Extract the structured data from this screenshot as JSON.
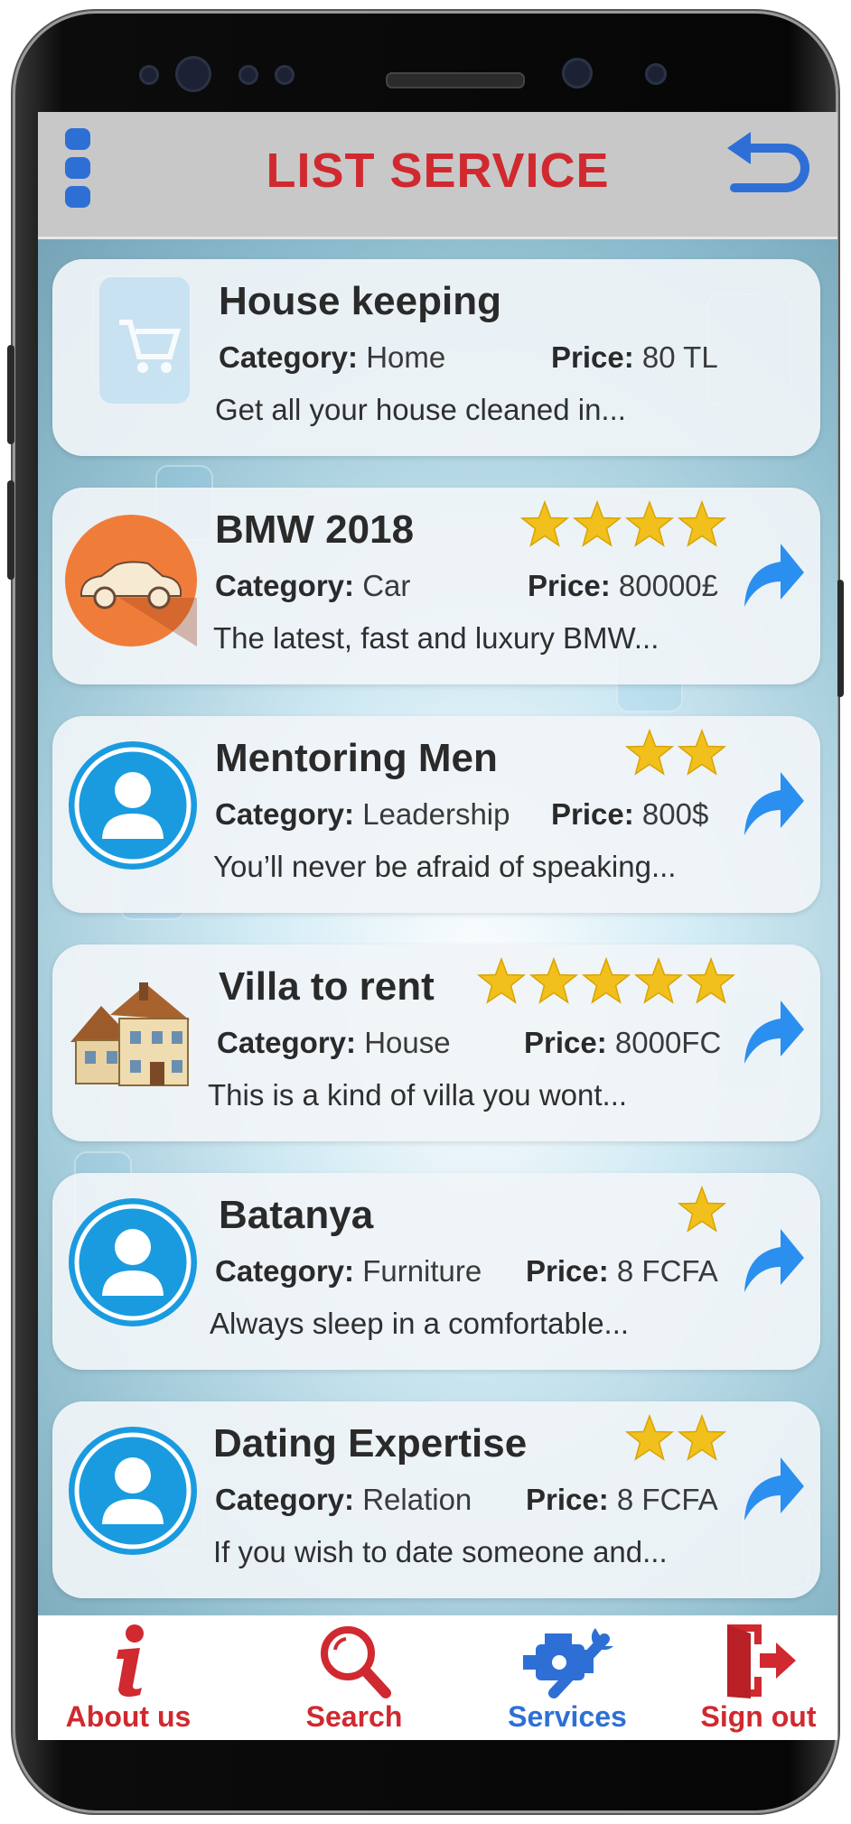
{
  "header": {
    "title": "LIST SERVICE",
    "menu_icon": "vertical-dots-icon",
    "back_icon": "undo-arrow-icon"
  },
  "services": [
    {
      "name": "House keeping",
      "category_label": "Category:",
      "category": " Home",
      "price_label": "Price:",
      "price": " 80 TL",
      "description": "Get all your house cleaned in...",
      "rating": 0,
      "image": "shopping-cart-icon"
    },
    {
      "name": "BMW 2018",
      "category_label": "Category:",
      "category": " Car",
      "price_label": "Price:",
      "price": " 80000£",
      "description": "The latest, fast and luxury BMW...",
      "rating": 4,
      "image": "car-icon"
    },
    {
      "name": "Mentoring Men",
      "category_label": "Category:",
      "category": " Leadership",
      "price_label": "Price:",
      "price": " 800$",
      "description": "You’ll never be afraid of speaking...",
      "rating": 2,
      "image": "user-avatar-icon"
    },
    {
      "name": "Villa to rent",
      "category_label": "Category:",
      "category": " House",
      "price_label": "Price:",
      "price": " 8000FC",
      "description": "This is a kind of villa you wont...",
      "rating": 5,
      "image": "villa-icon"
    },
    {
      "name": "Batanya",
      "category_label": "Category:",
      "category": " Furniture",
      "price_label": "Price:",
      "price": " 8 FCFA",
      "description": "Always sleep in a comfortable...",
      "rating": 1,
      "image": "user-avatar-icon"
    },
    {
      "name": "Dating Expertise",
      "category_label": "Category:",
      "category": " Relation",
      "price_label": "Price:",
      "price": " 8 FCFA",
      "description": "If you wish to date someone and...",
      "rating": 2,
      "image": "user-avatar-icon"
    }
  ],
  "tabs": [
    {
      "label": "About us",
      "icon": "info-icon",
      "color": "#d0292f",
      "active": false
    },
    {
      "label": "Search",
      "icon": "search-icon",
      "color": "#d0292f",
      "active": false
    },
    {
      "label": "Services",
      "icon": "engine-wrench-icon",
      "color": "#2e6fd6",
      "active": true
    },
    {
      "label": "Sign out",
      "icon": "exit-door-icon",
      "color": "#d0292f",
      "active": false
    }
  ],
  "colors": {
    "accent_red": "#d0292f",
    "accent_blue": "#2e6fd6",
    "star_gold": "#f2c01c",
    "avatar_blue": "#1a9be0",
    "share_blue": "#2b8ff0"
  }
}
